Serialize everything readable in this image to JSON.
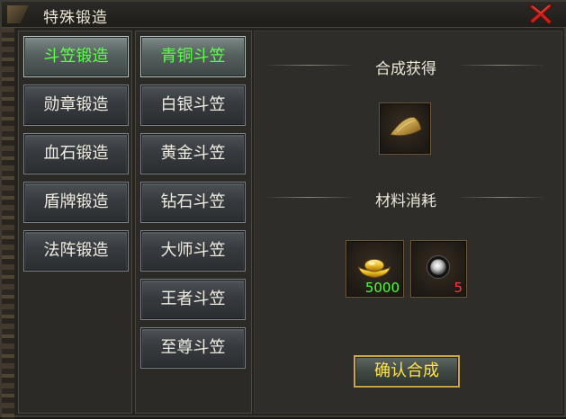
{
  "window": {
    "title": "特殊锻造",
    "close_icon": "close-x-icon"
  },
  "categories": [
    {
      "label": "斗笠锻造",
      "active": true
    },
    {
      "label": "勋章锻造",
      "active": false
    },
    {
      "label": "血石锻造",
      "active": false
    },
    {
      "label": "盾牌锻造",
      "active": false
    },
    {
      "label": "法阵锻造",
      "active": false
    }
  ],
  "items": [
    {
      "label": "青铜斗笠",
      "active": true
    },
    {
      "label": "白银斗笠",
      "active": false
    },
    {
      "label": "黄金斗笠",
      "active": false
    },
    {
      "label": "钻石斗笠",
      "active": false
    },
    {
      "label": "大师斗笠",
      "active": false
    },
    {
      "label": "王者斗笠",
      "active": false
    },
    {
      "label": "至尊斗笠",
      "active": false
    }
  ],
  "result": {
    "heading": "合成获得",
    "item_icon": "bamboo-hat-icon"
  },
  "materials": {
    "heading": "材料消耗",
    "list": [
      {
        "icon": "gold-ingot-icon",
        "count": "5000",
        "count_color": "#4cff3a"
      },
      {
        "icon": "silver-orb-icon",
        "count": "5",
        "count_color": "#ff3a3a"
      }
    ]
  },
  "confirm": {
    "label": "确认合成"
  },
  "colors": {
    "active_text": "#5dff4a",
    "confirm_text": "#ffe24a",
    "close_red": "#d62a2a"
  }
}
